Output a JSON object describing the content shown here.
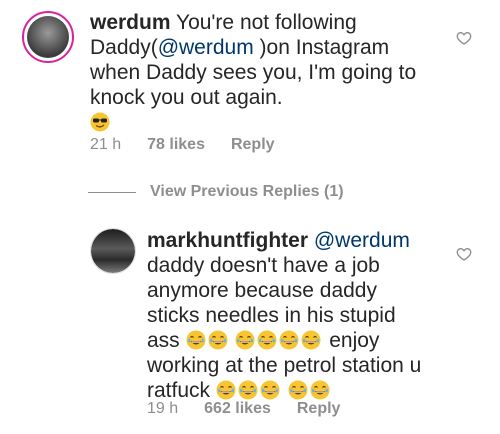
{
  "comments": [
    {
      "username": "werdum",
      "text_parts": [
        "You're not following Daddy(",
        "@werdum",
        " )on Instagram when Daddy sees you, I'm going to knock you out again."
      ],
      "emoji": "sunglasses-emoji",
      "time": "21 h",
      "likes": "78 likes",
      "reply": "Reply"
    },
    {
      "username": "markhuntfighter",
      "mention": "@werdum",
      "text_a": "daddy doesn't have a job anymore because daddy sticks needles in his stupid ass",
      "text_b": "enjoy working at the petrol station u ratfuck",
      "emoji": "laughing-emoji",
      "time": "19 h",
      "likes": "662 likes",
      "reply": "Reply"
    }
  ],
  "view_previous": "View Previous Replies (1)",
  "colors": {
    "text": "#262626",
    "muted": "#8e8e8e",
    "mention": "#00376b",
    "ring": "#d6249f",
    "emoji": "#f7c531"
  }
}
